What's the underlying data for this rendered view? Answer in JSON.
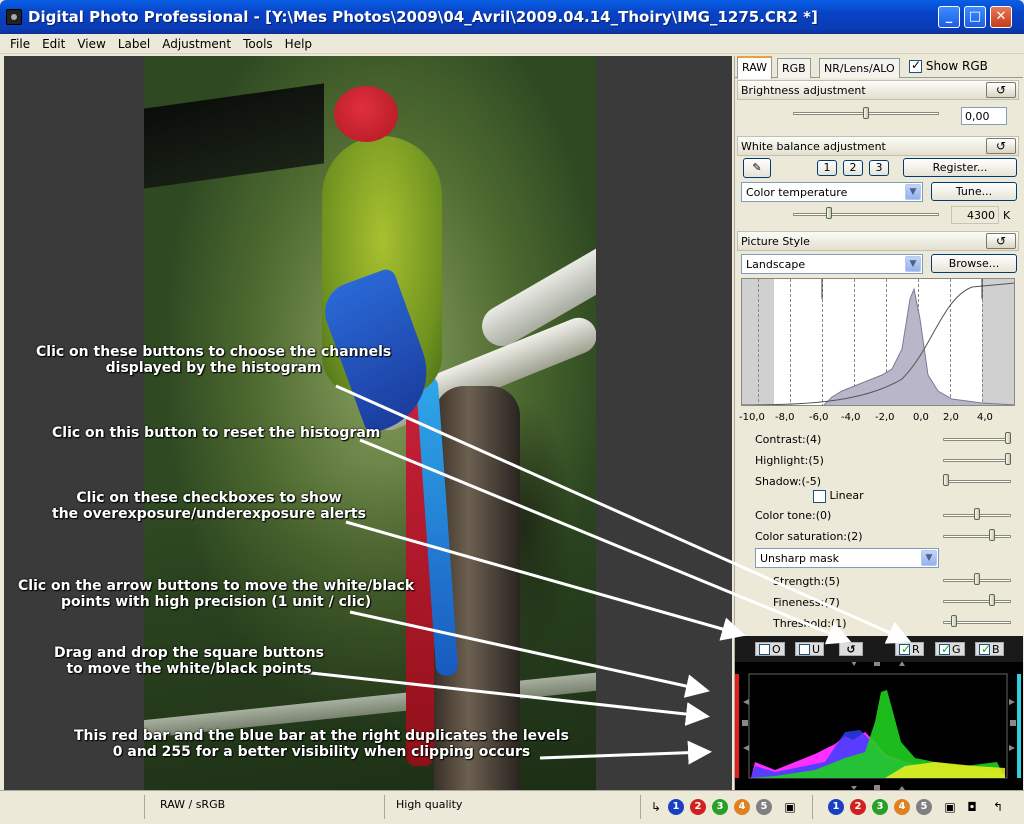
{
  "window": {
    "title": "Digital Photo Professional - [Y:\\Mes Photos\\2009\\04_Avril\\2009.04.14_Thoiry\\IMG_1275.CR2 *]",
    "minimize": "_",
    "maximize": "□",
    "close": "✕"
  },
  "menu": [
    "File",
    "Edit",
    "View",
    "Label",
    "Adjustment",
    "Tools",
    "Help"
  ],
  "panel": {
    "tabs": [
      "RAW",
      "RGB",
      "NR/Lens/ALO"
    ],
    "show_rgb": "Show RGB",
    "brightness": {
      "title": "Brightness adjustment",
      "value": "0,00",
      "reset": "↺"
    },
    "white_balance": {
      "title": "White balance adjustment",
      "reset": "↺",
      "eyedropper": "✎",
      "presets": [
        "1",
        "2",
        "3"
      ],
      "register": "Register...",
      "mode": "Color temperature",
      "tune": "Tune...",
      "temperature": "4300",
      "unit": "K"
    },
    "picture_style": {
      "title": "Picture Style",
      "reset": "↺",
      "style": "Landscape",
      "browse": "Browse...",
      "axis": [
        "-10,0",
        "-8,0",
        "-6,0",
        "-4,0",
        "-2,0",
        "0,0",
        "2,0",
        "4,0"
      ],
      "contrast": "Contrast:(4)",
      "highlight": "Highlight:(5)",
      "shadow": "Shadow:(-5)",
      "linear": "Linear",
      "color_tone": "Color tone:(0)",
      "color_saturation": "Color saturation:(2)",
      "sharpening": "Unsharp mask",
      "strength": "Strength:(5)",
      "fineness": "Fineness:(7)",
      "threshold": "Threshold:(1)"
    },
    "histogram": {
      "o_label": "O",
      "u_label": "U",
      "reset": "↺",
      "r": "R",
      "g": "G",
      "b": "B"
    }
  },
  "status": {
    "color_space": "RAW / sRGB",
    "quality": "High quality",
    "checks": [
      "1",
      "2",
      "3",
      "4",
      "5"
    ]
  },
  "annotations": {
    "a1": "Clic on these buttons to choose the channels",
    "a1b": "displayed by the histogram",
    "a2": "Clic on this button to reset the histogram",
    "a3": "Clic on these checkboxes to show",
    "a3b": "the overexposure/underexposure alerts",
    "a4": "Clic on the arrow buttons to move the white/black",
    "a4b": "points with high precision (1 unit / clic)",
    "a5": "Drag and drop the square buttons",
    "a5b": "to move the white/black points",
    "a6": "This red bar and the blue bar at the right duplicates the levels",
    "a6b": "0 and 255  for a better visibility when clipping occurs"
  }
}
